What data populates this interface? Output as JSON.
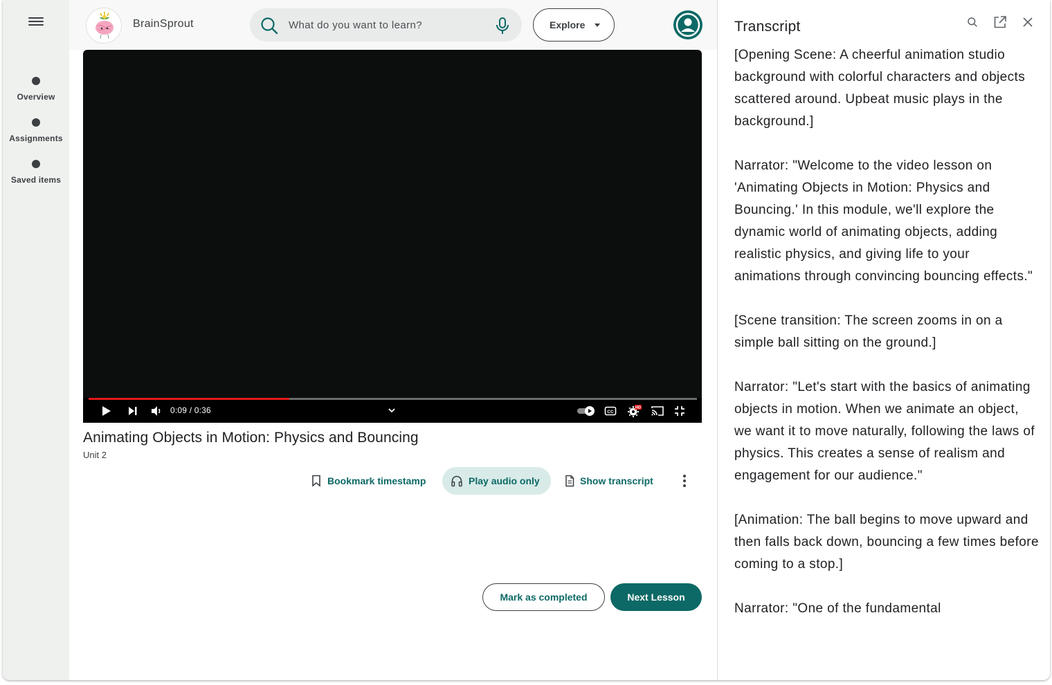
{
  "app": {
    "brand_name": "BrainSprout",
    "accent_color": "#0d6966",
    "icon": "brain-sprout-logo"
  },
  "sidebar": {
    "menu_icon": "hamburger-menu-icon",
    "items": [
      {
        "label": "Overview",
        "icon": "dot-icon"
      },
      {
        "label": "Assignments",
        "icon": "dot-icon"
      },
      {
        "label": "Saved items",
        "icon": "dot-icon"
      }
    ]
  },
  "header": {
    "search": {
      "placeholder": "What do you want to learn?",
      "value": "",
      "icon": "search-icon",
      "voice_icon": "microphone-icon"
    },
    "explore_label": "Explore",
    "avatar_icon": "user-avatar-icon"
  },
  "player": {
    "current_time": "0:09",
    "duration": "0:36",
    "time_display": "0:09 / 0:36",
    "progress": 0.33,
    "buffered": 0.33,
    "progress_color": "#e21818",
    "hd_badge": "HD"
  },
  "lesson": {
    "title": "Animating Objects in Motion: Physics and Bouncing",
    "unit": "Unit 2",
    "actions": {
      "bookmark": "Bookmark timestamp",
      "audio": "Play audio only",
      "transcript": "Show transcript"
    },
    "mark_completed": "Mark as completed",
    "next_lesson": "Next Lesson"
  },
  "transcript": {
    "title": "Transcript",
    "paragraphs": [
      "[Opening Scene: A cheerful animation studio background with colorful characters and objects scattered around. Upbeat music plays in the background.]",
      "Narrator: \"Welcome to the video lesson on 'Animating Objects in Motion: Physics and Bouncing.' In this module, we'll explore the dynamic world of animating objects, adding realistic physics, and giving life to your animations through convincing bouncing effects.\"",
      "[Scene transition: The screen zooms in on a simple ball sitting on the ground.]",
      "Narrator: \"Let's start with the basics of animating objects in motion. When we animate an object, we want it to move naturally, following the laws of physics. This creates a sense of realism and engagement for our audience.\"",
      "[Animation: The ball begins to move upward and then falls back down, bouncing a few times before coming to a stop.]",
      "Narrator: \"One of the fundamental"
    ]
  }
}
